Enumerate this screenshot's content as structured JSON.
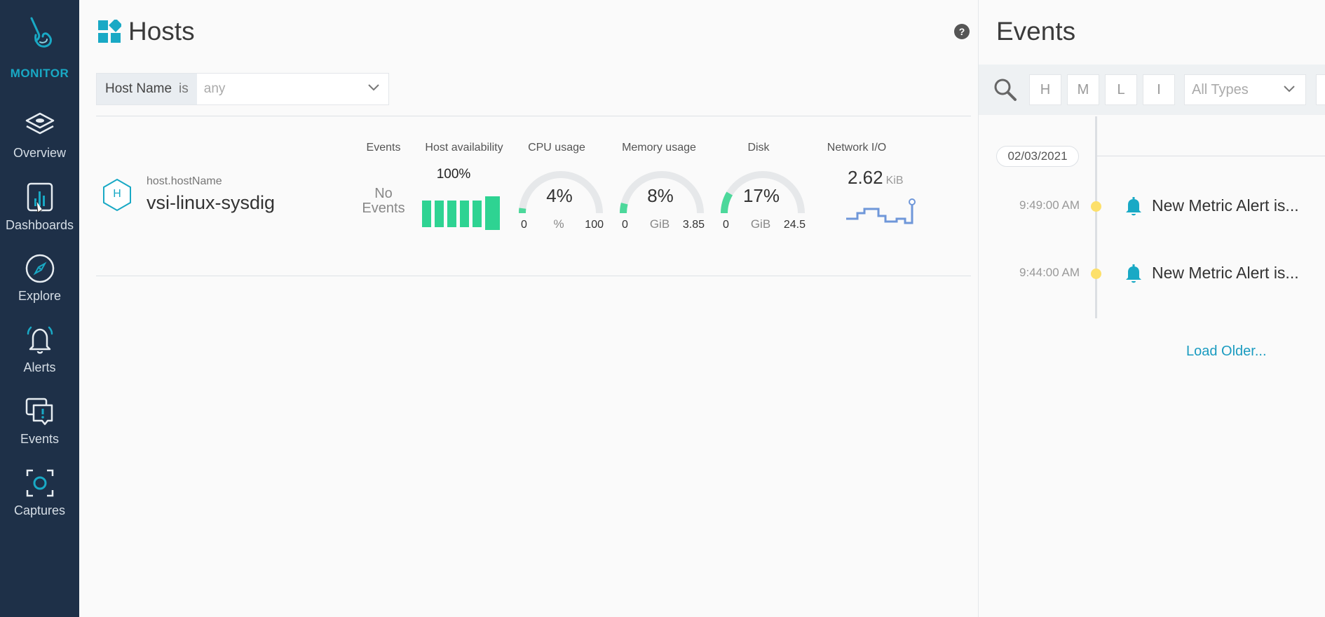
{
  "sidebar": {
    "brand_label": "MONITOR",
    "items": [
      {
        "label": "Overview",
        "icon": "layers-icon"
      },
      {
        "label": "Dashboards",
        "icon": "dashboard-icon"
      },
      {
        "label": "Explore",
        "icon": "compass-icon"
      },
      {
        "label": "Alerts",
        "icon": "bell-icon"
      },
      {
        "label": "Events",
        "icon": "chat-icon"
      },
      {
        "label": "Captures",
        "icon": "capture-icon"
      }
    ]
  },
  "hosts": {
    "title": "Hosts",
    "filter": {
      "key": "Host Name",
      "operator": "is",
      "placeholder": "any"
    },
    "columns": {
      "events": "Events",
      "availability": "Host availability",
      "cpu": "CPU usage",
      "memory": "Memory usage",
      "disk": "Disk",
      "network": "Network I/O"
    },
    "row": {
      "badge": "H",
      "key_label": "host.hostName",
      "name": "vsi-linux-sysdig",
      "events_text": "No Events",
      "availability": "100%",
      "cpu": {
        "value": "4%",
        "min": "0",
        "unit": "%",
        "max": "100",
        "fraction": 0.04
      },
      "memory": {
        "value": "8%",
        "min": "0",
        "unit": "GiB",
        "max": "3.85",
        "fraction": 0.08
      },
      "disk": {
        "value": "17%",
        "min": "0",
        "unit": "GiB",
        "max": "24.5",
        "fraction": 0.17
      },
      "network": {
        "value": "2.62",
        "unit": "KiB"
      }
    }
  },
  "events": {
    "title": "Events",
    "severity_buttons": [
      "H",
      "M",
      "L",
      "I"
    ],
    "type_filter": "All Types",
    "date": "02/03/2021",
    "items": [
      {
        "time": "9:49:00 AM",
        "text": "New Metric Alert is..."
      },
      {
        "time": "9:44:00 AM",
        "text": "New Metric Alert is..."
      }
    ],
    "load_older": "Load Older..."
  },
  "colors": {
    "sidebar_bg": "#1e3048",
    "accent": "#19a9c5",
    "gauge_fill": "#4cd89b",
    "availability_bar": "#2ed392",
    "event_dot": "#fde06a",
    "link": "#1a9bc0"
  }
}
